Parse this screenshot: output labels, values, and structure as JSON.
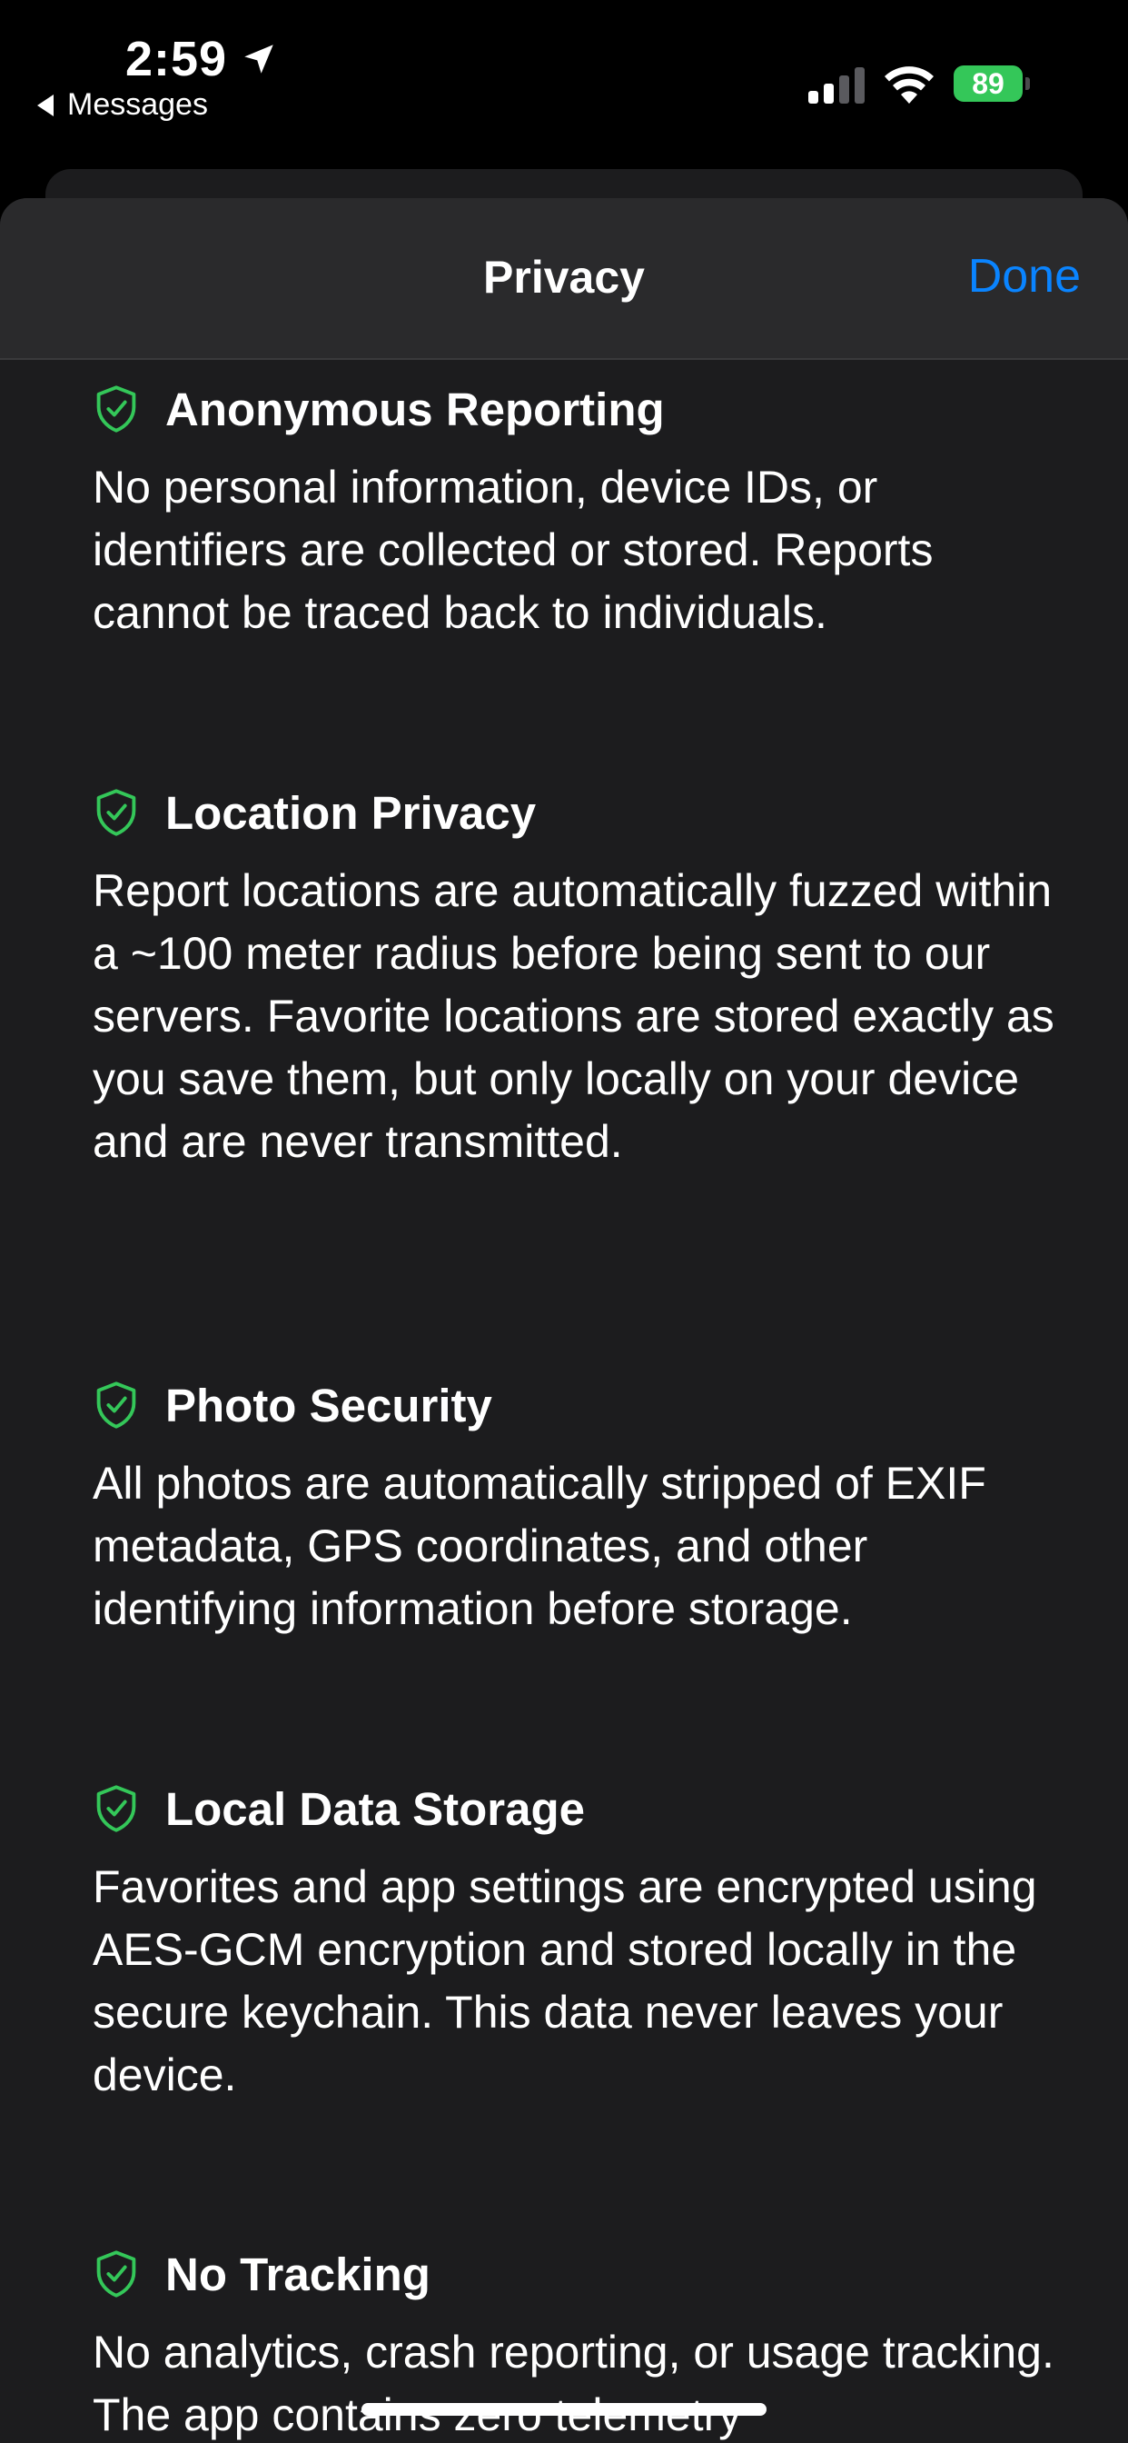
{
  "status_bar": {
    "time": "2:59",
    "back_label": "Messages",
    "battery": "89"
  },
  "nav": {
    "title": "Privacy",
    "done_label": "Done"
  },
  "colors": {
    "accent": "#0a84ff",
    "shield": "#34c759",
    "battery": "#34c759",
    "sheet_background": "#1c1c1e"
  },
  "sections": [
    {
      "icon": "shield-check-icon",
      "title": "Anonymous Reporting",
      "body": "No personal information, device IDs, or identifiers are collected or stored. Reports cannot be traced back to individuals."
    },
    {
      "icon": "shield-check-icon",
      "title": "Location Privacy",
      "body": "Report locations are automatically fuzzed within a ~100 meter radius before being sent to our servers. Favorite locations are stored exactly as you save them, but only locally on your device and are never transmitted."
    },
    {
      "icon": "shield-check-icon",
      "title": "Photo Security",
      "body": "All photos are automatically stripped of EXIF metadata, GPS coordinates, and other identifying information before storage."
    },
    {
      "icon": "shield-check-icon",
      "title": "Local Data Storage",
      "body": "Favorites and app settings are encrypted using AES-GCM encryption and stored locally in the secure keychain. This data never leaves your device."
    },
    {
      "icon": "shield-check-icon",
      "title": "No Tracking",
      "body": "No analytics, crash reporting, or usage tracking. The app contains zero telemetry"
    }
  ]
}
